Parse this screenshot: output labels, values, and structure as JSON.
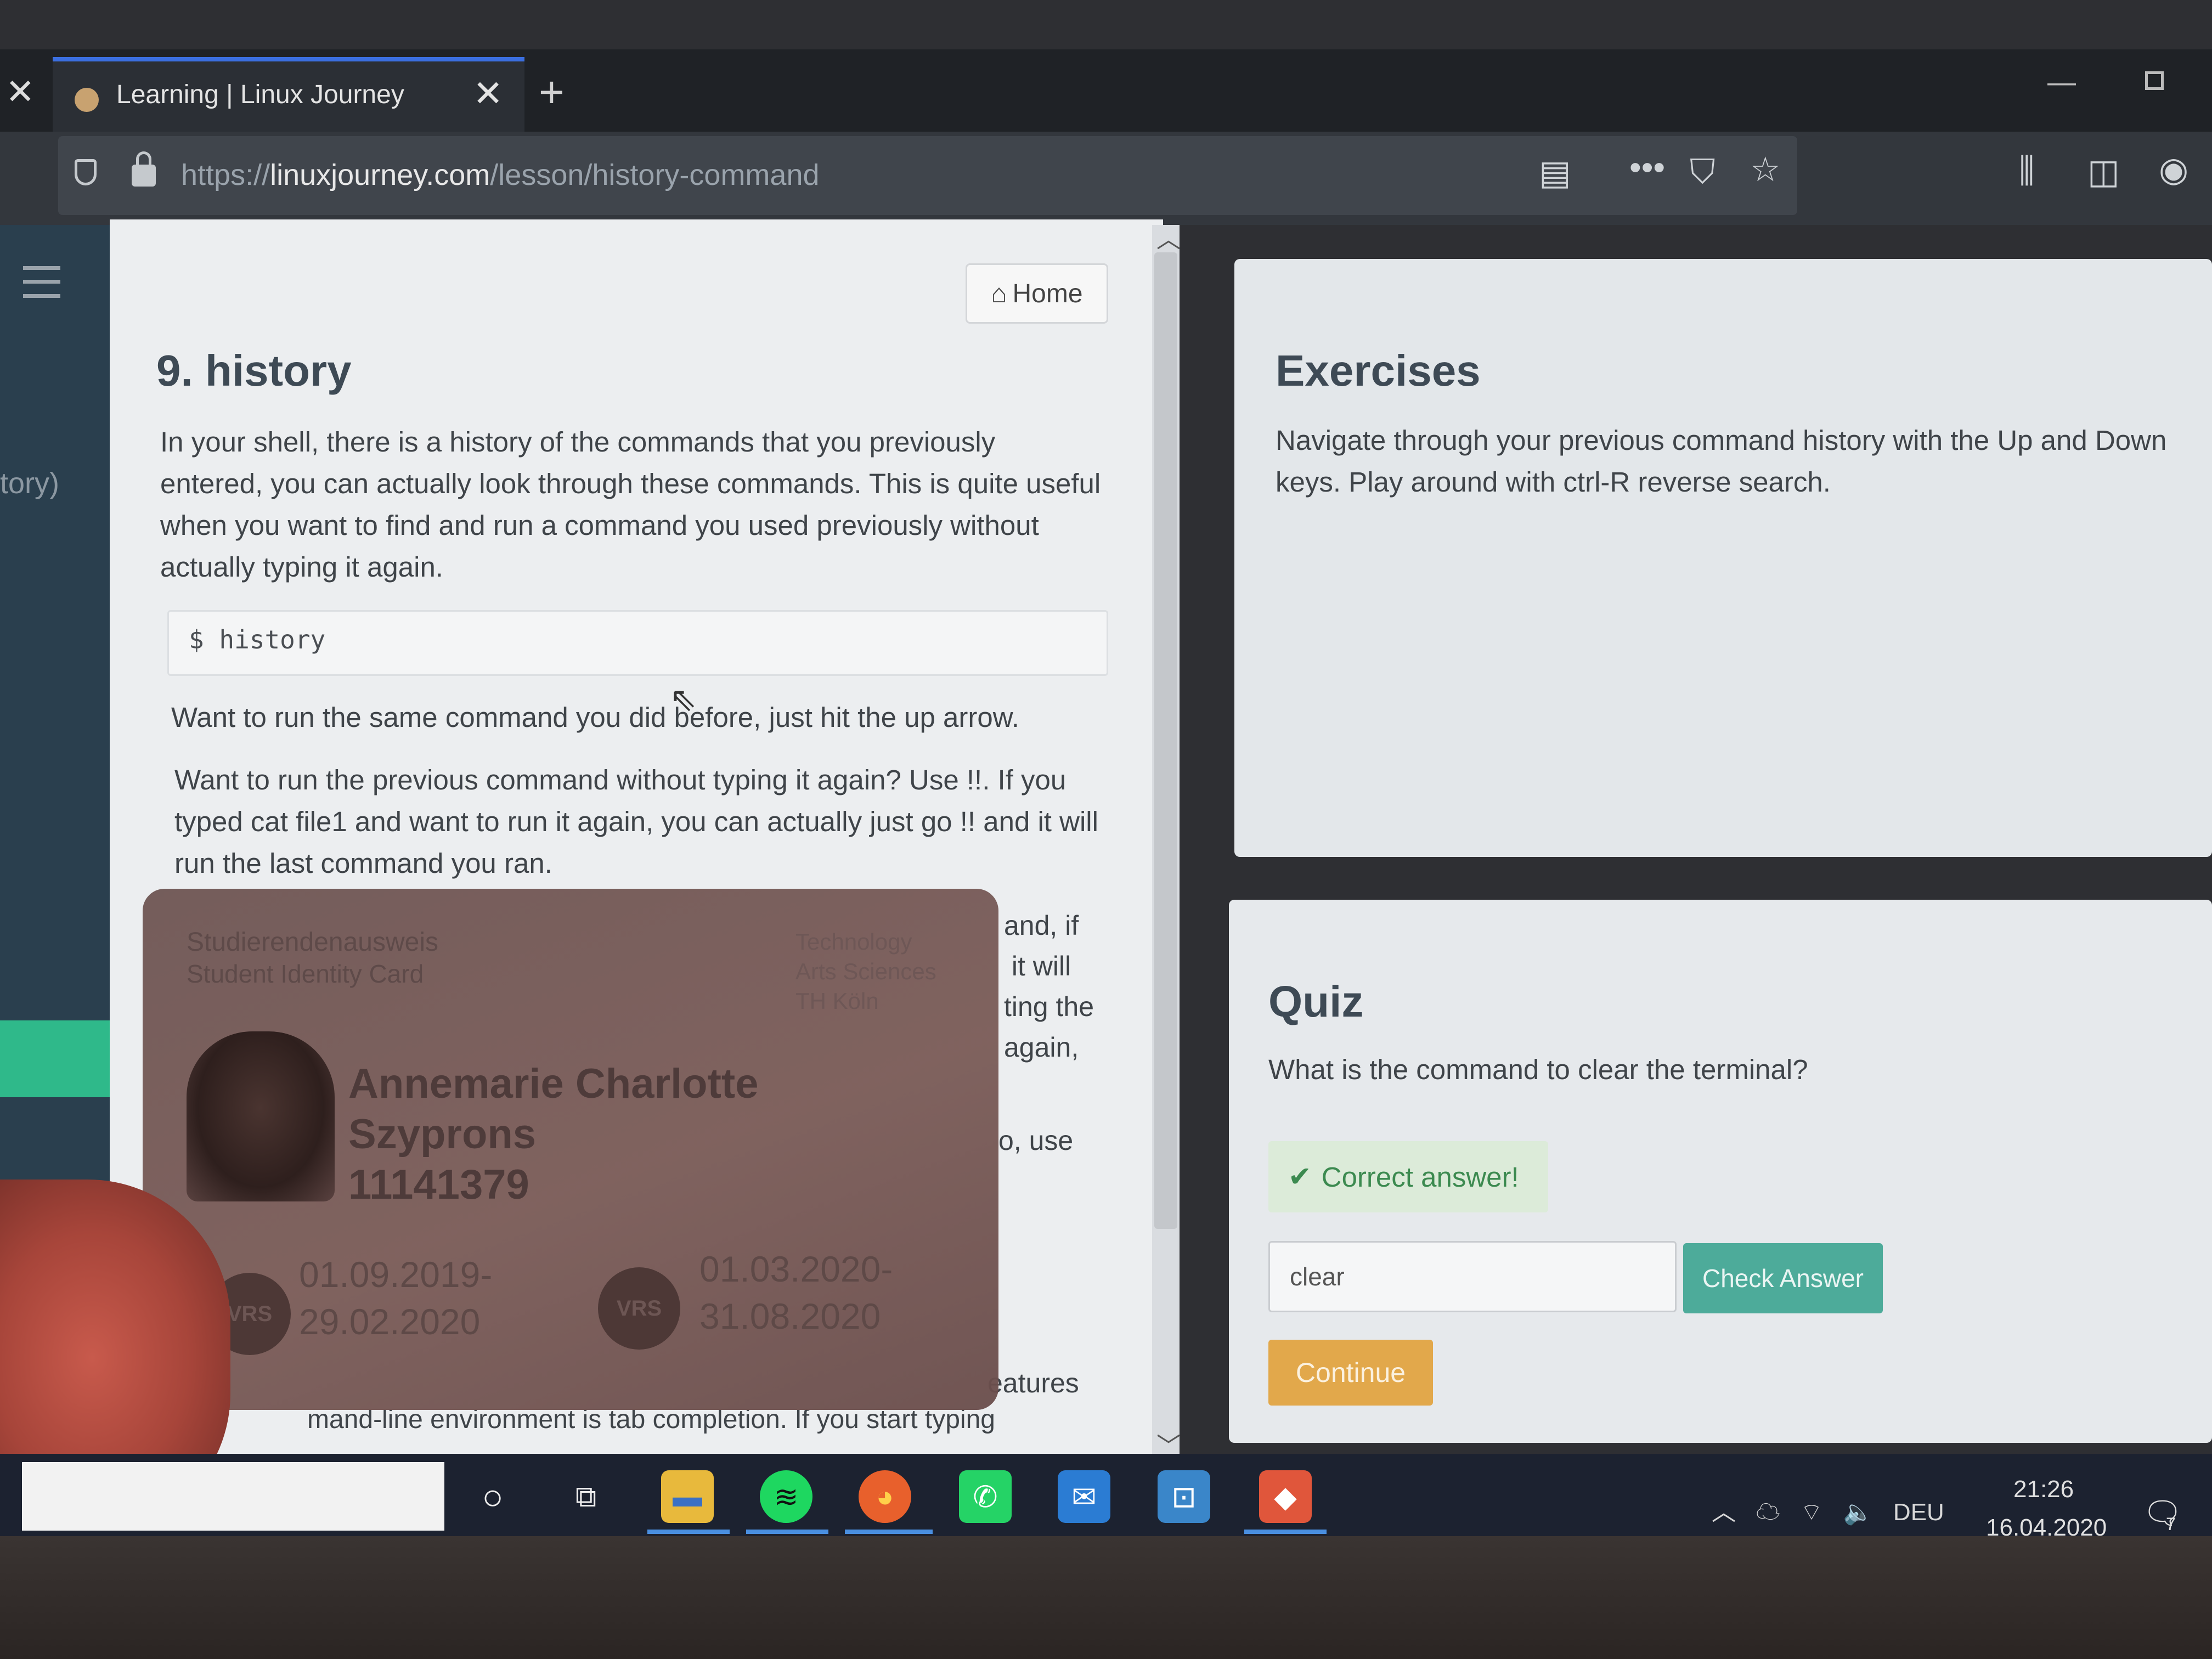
{
  "browser": {
    "tab_title": "Learning | Linux Journey",
    "url_scheme": "https://",
    "url_domain": "linuxjourney.com",
    "url_path": "/lesson/history-command"
  },
  "sidebar": {
    "partial_label": "tory)"
  },
  "lesson": {
    "home_label": "Home",
    "title": "9. history",
    "para1": "In your shell, there is a history of the commands that you previously entered, you can actually look through these commands. This is quite useful when you want to find and run a command you used previously without actually typing it again.",
    "command": "$ history",
    "para2": "Want to run the same command you did before, just hit the up arrow.",
    "para3": "Want to run the previous command without typing it again? Use !!. If you typed cat file1 and want to run it again, you can actually just go !! and it will run the last command you ran.",
    "frag1": "and, if\n it will\nting the\nagain,",
    "frag2": "o, use",
    "frag3": "eatures",
    "para4": "mand-line environment is tab completion. If you start typing"
  },
  "id_card": {
    "heading_de": "Studierendenausweis",
    "heading_en": "Student Identity Card",
    "institution": "Technology\nArts Sciences\nTH Köln",
    "name_line1": "Annemarie Charlotte",
    "name_line2": "Szyprons",
    "student_number": "11141379",
    "seal_label": "VRS",
    "period1": "01.09.2019-\n29.02.2020",
    "period2": "01.03.2020-\n31.08.2020"
  },
  "exercises": {
    "title": "Exercises",
    "text": "Navigate through your previous command history with the Up and Down keys. Play around with ctrl-R reverse search."
  },
  "quiz": {
    "title": "Quiz",
    "question": "What is the command to clear the terminal?",
    "result": "Correct answer!",
    "answer_value": "clear",
    "check_label": "Check Answer",
    "continue_label": "Continue"
  },
  "taskbar": {
    "language": "DEU",
    "time": "21:26",
    "date": "16.04.2020",
    "notification_count": "7",
    "apps": [
      "cortana-icon",
      "task-view-icon",
      "file-explorer-icon",
      "spotify-icon",
      "firefox-icon",
      "whatsapp-icon",
      "mail-icon",
      "app-icon",
      "git-icon"
    ]
  },
  "colors": {
    "accent_green": "#2fb98a",
    "check_button": "#4dab9a",
    "continue_button": "#e2a84b",
    "correct_text": "#3c8a50"
  }
}
